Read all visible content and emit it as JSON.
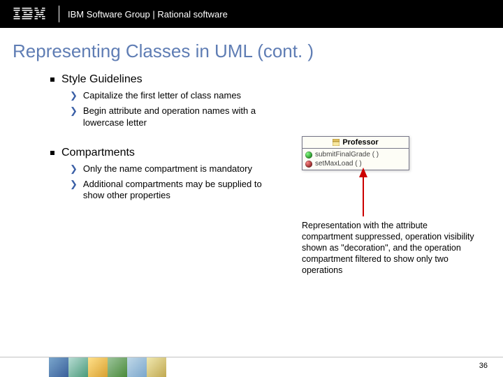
{
  "header": {
    "group_text": "IBM Software Group | Rational software"
  },
  "title": "Representing Classes in UML (cont. )",
  "sections": [
    {
      "heading": "Style Guidelines",
      "items": [
        "Capitalize the first letter of class names",
        "Begin attribute and operation names with a lowercase letter"
      ]
    },
    {
      "heading": "Compartments",
      "items": [
        "Only the name compartment is mandatory",
        "Additional compartments may be supplied to show other properties"
      ]
    }
  ],
  "uml": {
    "class_name": "Professor",
    "ops": [
      {
        "vis": "green",
        "sig": "submitFinalGrade ( )"
      },
      {
        "vis": "red",
        "sig": "setMaxLoad ( )"
      }
    ]
  },
  "caption": "Representation with the attribute compartment suppressed, operation visibility shown as \"decoration\", and the operation compartment filtered to show only two operations",
  "slide_number": "36"
}
